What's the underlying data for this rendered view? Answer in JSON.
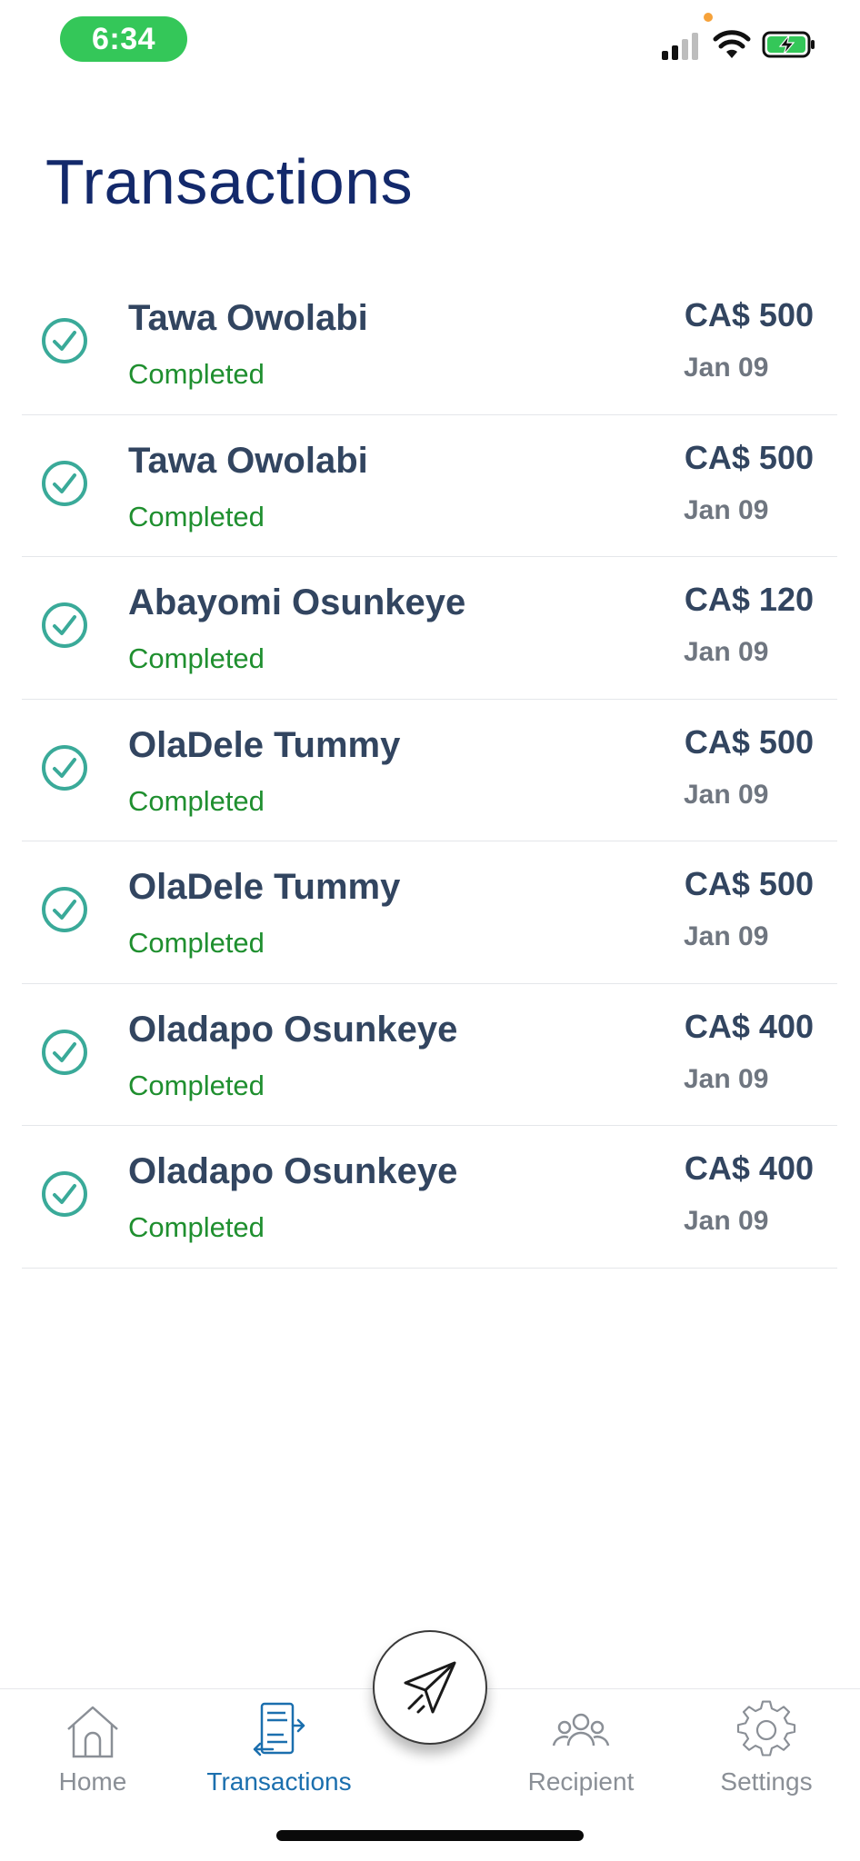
{
  "status_bar": {
    "time": "6:34"
  },
  "page": {
    "title": "Transactions"
  },
  "transactions": [
    {
      "name": "Tawa Owolabi",
      "status": "Completed",
      "amount": "CA$ 500",
      "date": "Jan 09"
    },
    {
      "name": "Tawa Owolabi",
      "status": "Completed",
      "amount": "CA$ 500",
      "date": "Jan 09"
    },
    {
      "name": "Abayomi Osunkeye",
      "status": "Completed",
      "amount": "CA$ 120",
      "date": "Jan 09"
    },
    {
      "name": "OlaDele Tummy",
      "status": "Completed",
      "amount": "CA$ 500",
      "date": "Jan 09"
    },
    {
      "name": "OlaDele Tummy",
      "status": "Completed",
      "amount": "CA$ 500",
      "date": "Jan 09"
    },
    {
      "name": "Oladapo Osunkeye",
      "status": "Completed",
      "amount": "CA$ 400",
      "date": "Jan 09"
    },
    {
      "name": "Oladapo Osunkeye",
      "status": "Completed",
      "amount": "CA$ 400",
      "date": "Jan 09"
    }
  ],
  "tabs": [
    {
      "label": "Home",
      "icon": "home-icon"
    },
    {
      "label": "Transactions",
      "icon": "transactions-icon",
      "active": true
    },
    {
      "label": "Recipient",
      "icon": "recipient-icon"
    },
    {
      "label": "Settings",
      "icon": "settings-icon"
    }
  ],
  "send_button": {
    "icon": "paper-plane-icon"
  },
  "colors": {
    "title": "#13296b",
    "completed": "#1f8f2f",
    "check": "#3aaa99",
    "active_tab": "#1b6fae",
    "time_pill": "#34c759"
  }
}
